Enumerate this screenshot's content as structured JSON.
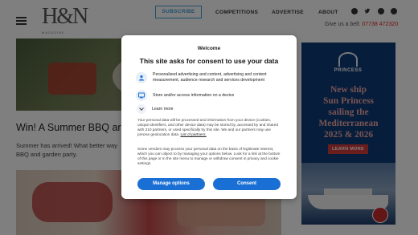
{
  "header": {
    "logo_text": "H&N",
    "logo_subtext": "MAGAZINE",
    "subscribe_label": "SUBSCRIBE",
    "nav": [
      "COMPETITIONS",
      "ADVERTISE",
      "ABOUT"
    ],
    "social_icons": [
      "facebook-icon",
      "twitter-icon",
      "instagram-icon",
      "pinterest-icon"
    ],
    "phone_prefix": "Give us a bell:",
    "phone_number": "07738 472320"
  },
  "article": {
    "title": "Win! A Summer BBQ ar",
    "text": "Summer has arrived! What better way BBQ and garden party."
  },
  "ad": {
    "brand": "PRINCESS",
    "headline_lines": [
      "New ship",
      "Sun Princess",
      "sailing the",
      "Mediterranean",
      "2025 & 2026"
    ],
    "cta": "LEARN MORE",
    "colors": {
      "background": "#0f3a78",
      "headline": "#f0a9a4",
      "cta": "#d23a3a"
    }
  },
  "consent": {
    "welcome": "Welcome",
    "title": "This site asks for consent to use your data",
    "purposes": [
      {
        "icon": "person-icon",
        "text": "Personalised advertising and content, advertising and content measurement, audience research and services development"
      },
      {
        "icon": "device-icon",
        "text": "Store and/or access information on a device"
      }
    ],
    "learn_more": "Learn more",
    "para1": "Your personal data will be processed and information from your device (cookies, unique identifiers, and other device data) may be stored by, accessed by and shared with 210 partners, or used specifically by this site. We and our partners may use precise geolocation data.",
    "partners_link": "List of partners.",
    "para2": "Some vendors may process your personal data on the basis of legitimate interest, which you can object to by managing your options below. Look for a link at the bottom of this page or in the site menu to manage or withdraw consent in privacy and cookie settings.",
    "manage_button": "Manage options",
    "consent_button": "Consent",
    "colors": {
      "button": "#1a6fd5"
    }
  }
}
